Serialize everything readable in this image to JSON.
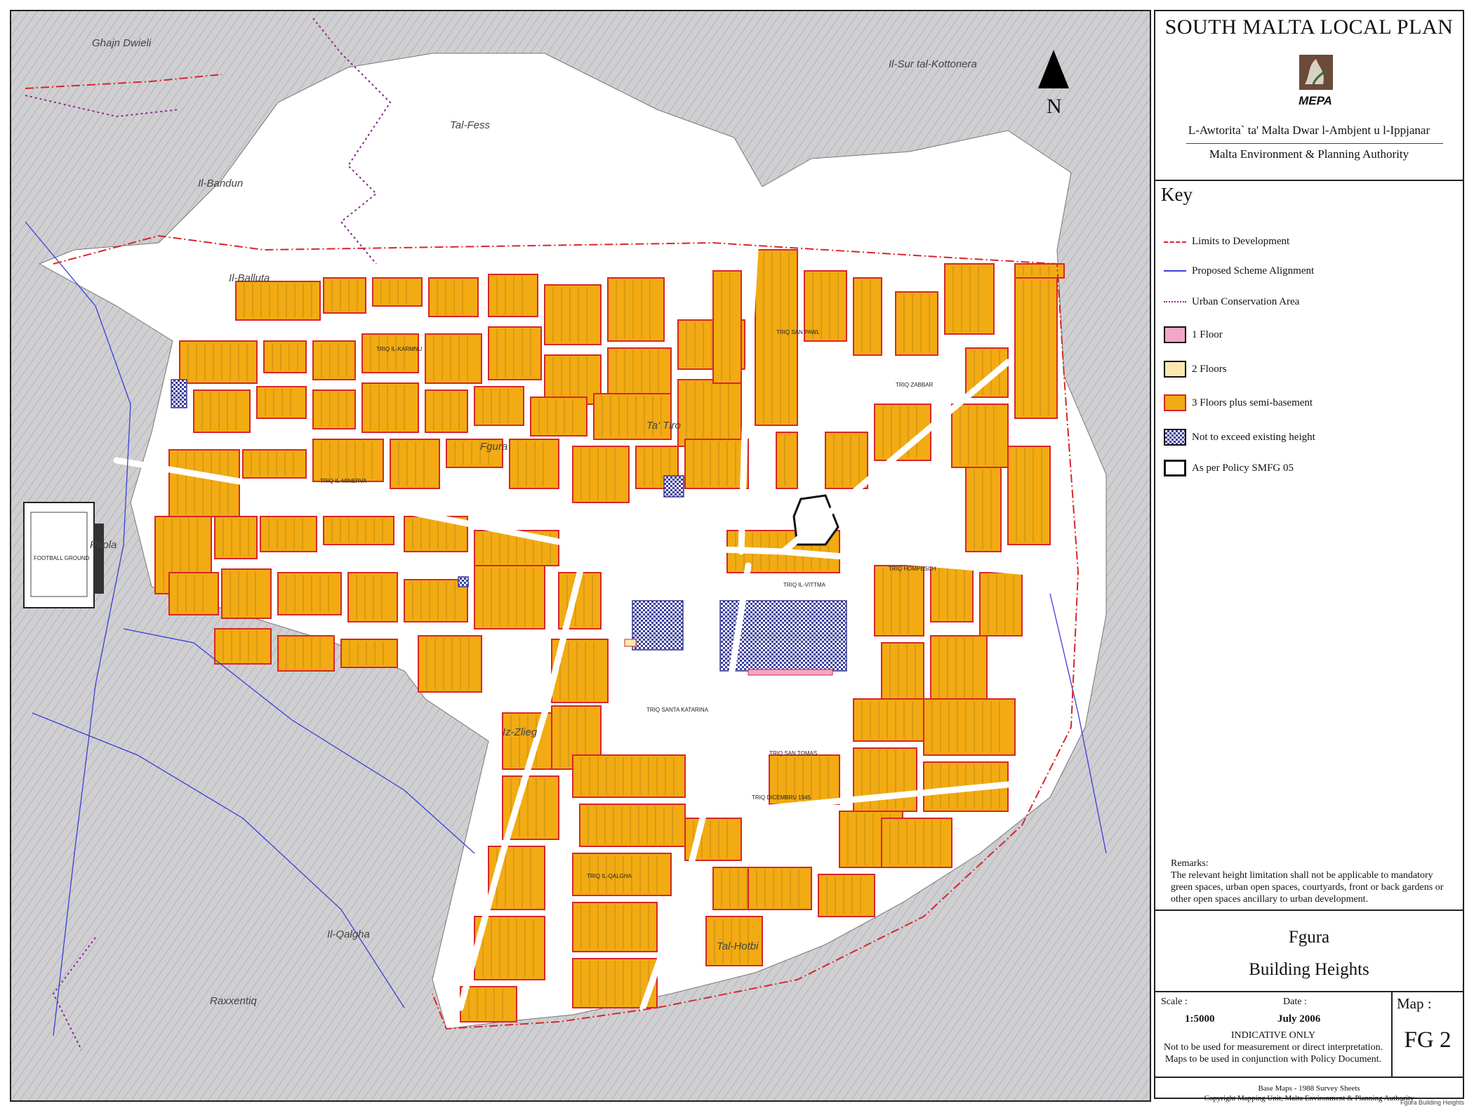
{
  "panel": {
    "title": "SOUTH MALTA LOCAL PLAN",
    "logo_text": "MEPA",
    "authority_mt": "L-Awtorita` ta' Malta Dwar l-Ambjent u l-Ippjanar",
    "authority_en": "Malta Environment & Planning Authority"
  },
  "key": {
    "heading": "Key",
    "items": [
      {
        "label": "Limits to Development",
        "symbol": "red-dash-dot-line",
        "color": "#d8262a"
      },
      {
        "label": "Proposed Scheme Alignment",
        "symbol": "blue-line",
        "color": "#3a3ed8"
      },
      {
        "label": "Urban Conservation Area",
        "symbol": "purple-dotted-line",
        "color": "#8a2a8e"
      },
      {
        "label": "1 Floor",
        "symbol": "pink-box",
        "color": "#f4a6c8"
      },
      {
        "label": "2 Floors",
        "symbol": "cream-box",
        "color": "#fbe8b0"
      },
      {
        "label": "3 Floors plus semi-basement",
        "symbol": "orange-box",
        "color": "#f2ab12"
      },
      {
        "label": "Not to exceed existing height",
        "symbol": "blue-checker-box",
        "color": "#3a3e9a"
      },
      {
        "label": "As per Policy SMFG 05",
        "symbol": "black-outline-box",
        "color": "#111111"
      }
    ]
  },
  "remarks": {
    "heading": "Remarks:",
    "text": "The relevant height limitation shall not be applicable to mandatory green spaces, urban open spaces, courtyards, front or back gardens or other open spaces ancillary to urban development."
  },
  "map_info": {
    "place": "Fgura",
    "map_title": "Building Heights",
    "scale_label": "Scale :",
    "scale_value": "1:5000",
    "date_label": "Date :",
    "date_value": "July 2006",
    "indicative": "INDICATIVE ONLY",
    "indicative_note_1": "Not to be used for measurement or direct interpretation.",
    "indicative_note_2": "Maps to be used in conjunction with Policy Document.",
    "map_label": "Map :",
    "map_number": "FG 2",
    "base_maps": "Base Maps - 1988 Survey Sheets",
    "copyright": "Copyright Mapping Unit, Malta Environment & Planning Authority",
    "footnote": "Fgura Building Heights"
  },
  "map": {
    "north_label": "N",
    "place_labels": [
      "Ghajn Dwieli",
      "Tal-Fess",
      "Il-Balluta",
      "Fgura",
      "Ta' Tiro",
      "Iz-Zlieg",
      "Tal-Hotbi",
      "Il-Qalgha",
      "Paola",
      "Raxxentiq",
      "Il-Bandun",
      "Il-Sur tal-Kottonera"
    ],
    "street_labels": [
      "TRIQ HOMPESCH",
      "TRIQ IL-VITTMA",
      "TRIQ IL-MINERVA",
      "TRIQ SAN TOMAS",
      "TRIQ SANTA KATARINA",
      "TRIQ IL-KARMNU",
      "TRIQ ZABBAR",
      "TRIQ IL-QALGHA",
      "TRIQ DICEMBRU 1945",
      "TRIQ SAN PAWL"
    ],
    "stadium_label": "FOOTBALL GROUND",
    "colors": {
      "background": "#cfcfd2",
      "white_area": "#ffffff",
      "block_fill": "#f2ab12",
      "block_outline": "#d8262a",
      "scheme_line": "#3a3ed8",
      "checker": "#3a3e9a",
      "pink": "#f4a6c8"
    }
  }
}
